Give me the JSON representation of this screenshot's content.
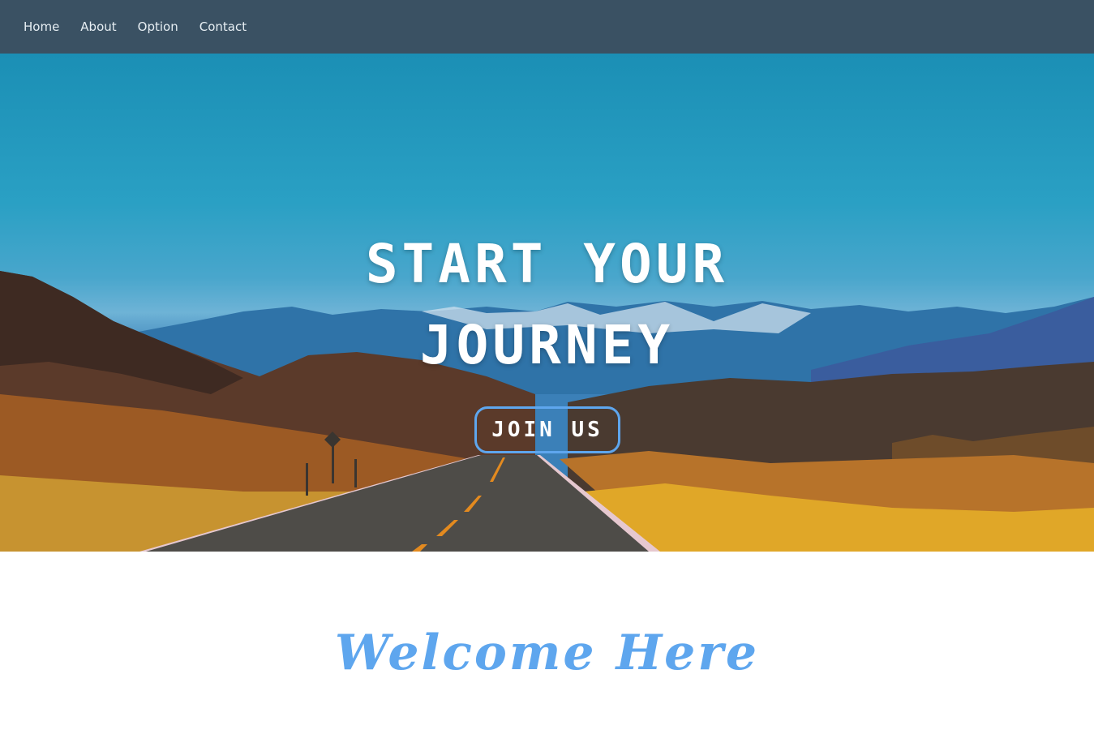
{
  "nav": {
    "items": [
      {
        "label": "Home"
      },
      {
        "label": "About"
      },
      {
        "label": "Option"
      },
      {
        "label": "Contact"
      }
    ]
  },
  "hero": {
    "title_line1": "START YOUR",
    "title_line2": "JOURNEY",
    "cta_label": "JOIN US"
  },
  "welcome": {
    "heading": "Welcome Here"
  },
  "colors": {
    "navbar": "#3a5163",
    "accent": "#5ea6ee",
    "sky": "#2aa0c4"
  }
}
